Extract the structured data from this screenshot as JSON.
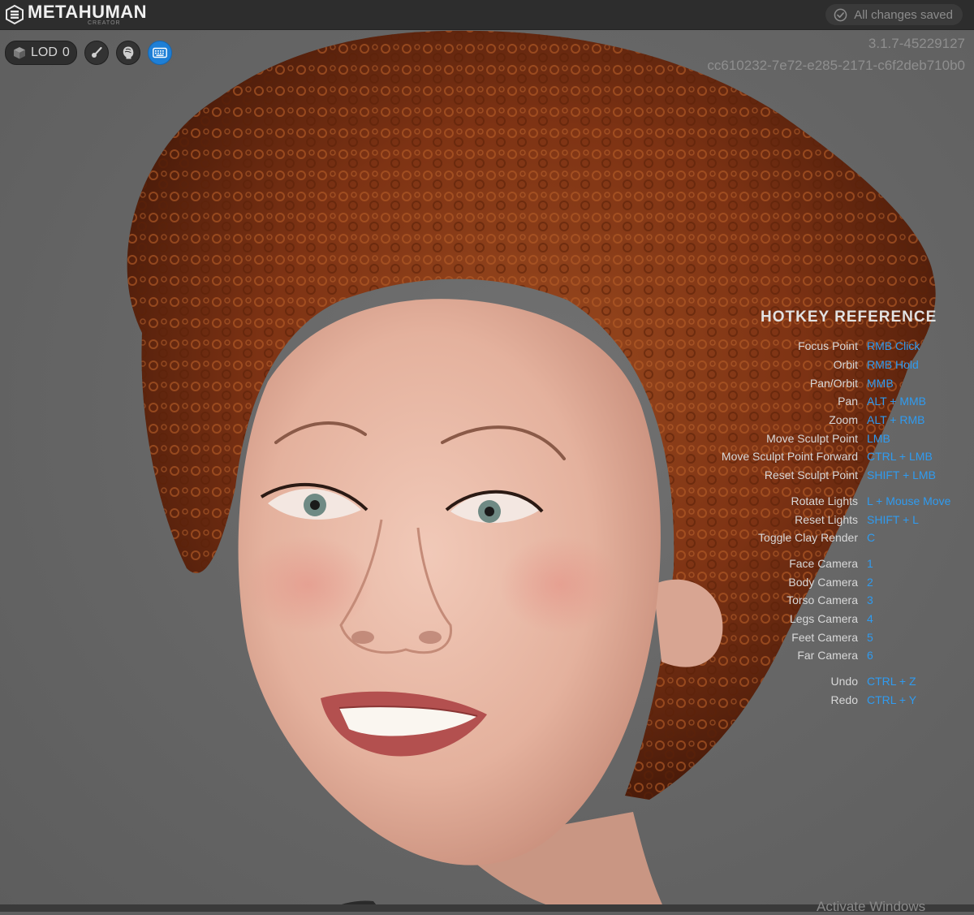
{
  "app": {
    "brand_name": "METAHUMAN",
    "brand_sub": "CREATOR",
    "save_status": "All changes saved"
  },
  "toolbar": {
    "lod_label": "LOD",
    "lod_value": "0",
    "buttons": [
      {
        "name": "lighting",
        "icon": "brush-icon"
      },
      {
        "name": "render",
        "icon": "head-icon"
      },
      {
        "name": "hotkeys",
        "icon": "keyboard-icon",
        "active": true
      }
    ]
  },
  "version": {
    "number": "3.1.7-45229127",
    "hash": "cc610232-7e72-e285-2171-c6f2deb710b0"
  },
  "hotkeys": {
    "title": "HOTKEY REFERENCE",
    "groups": [
      [
        {
          "action": "Focus Point",
          "key": "RMB Click"
        },
        {
          "action": "Orbit",
          "key": "RMB Hold"
        },
        {
          "action": "Pan/Orbit",
          "key": "MMB"
        },
        {
          "action": "Pan",
          "key": "ALT + MMB"
        },
        {
          "action": "Zoom",
          "key": "ALT + RMB"
        },
        {
          "action": "Move Sculpt Point",
          "key": "LMB"
        },
        {
          "action": "Move Sculpt Point Forward",
          "key": "CTRL + LMB"
        },
        {
          "action": "Reset Sculpt Point",
          "key": "SHIFT + LMB"
        }
      ],
      [
        {
          "action": "Rotate Lights",
          "key": "L + Mouse Move"
        },
        {
          "action": "Reset Lights",
          "key": "SHIFT + L"
        },
        {
          "action": "Toggle Clay Render",
          "key": "C"
        }
      ],
      [
        {
          "action": "Face Camera",
          "key": "1"
        },
        {
          "action": "Body Camera",
          "key": "2"
        },
        {
          "action": "Torso Camera",
          "key": "3"
        },
        {
          "action": "Legs Camera",
          "key": "4"
        },
        {
          "action": "Feet Camera",
          "key": "5"
        },
        {
          "action": "Far Camera",
          "key": "6"
        }
      ],
      [
        {
          "action": "Undo",
          "key": "CTRL + Z"
        },
        {
          "action": "Redo",
          "key": "CTRL + Y"
        }
      ]
    ]
  },
  "watermark": "Activate Windows",
  "colors": {
    "topbar": "#2d2d2d",
    "accent": "#1e7fd6",
    "hotkey_key": "#2f9bf0",
    "hair": "#8a3a17",
    "skin": "#e7b7a4",
    "background": "#676767"
  }
}
